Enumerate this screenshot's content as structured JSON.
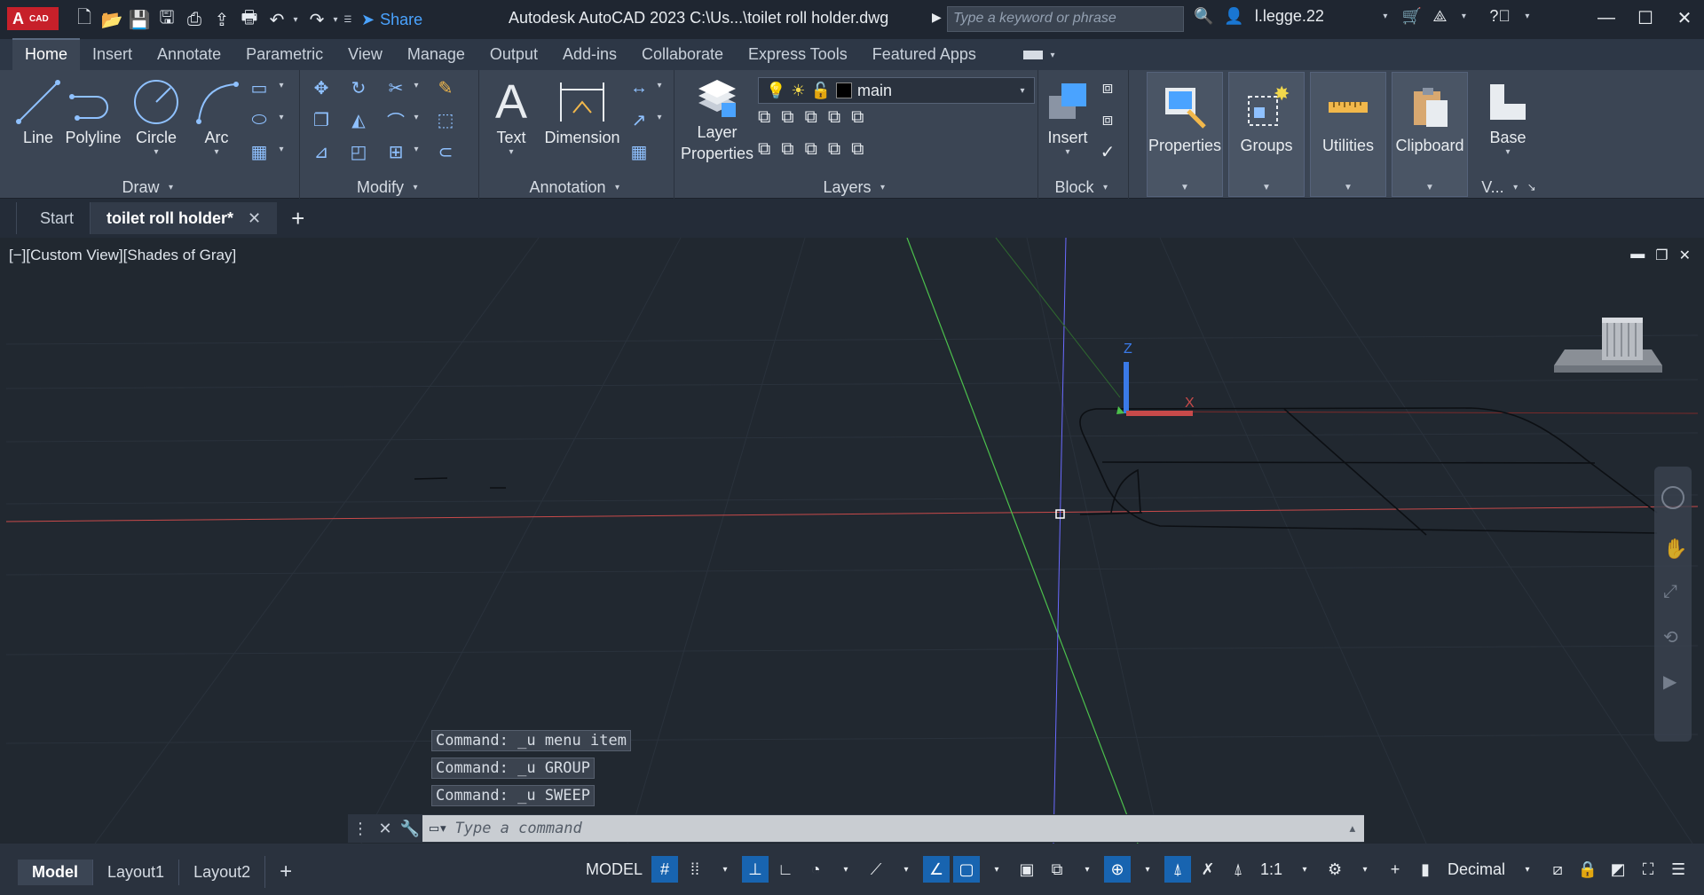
{
  "titlebar": {
    "app_logo": "A",
    "app_logo_sub": "CAD",
    "share_label": "Share",
    "title": "Autodesk AutoCAD 2023    C:\\Us...\\toilet roll holder.dwg",
    "search_placeholder": "Type a keyword or phrase",
    "username": "l.legge.22"
  },
  "ribbon_tabs": [
    "Home",
    "Insert",
    "Annotate",
    "Parametric",
    "View",
    "Manage",
    "Output",
    "Add-ins",
    "Collaborate",
    "Express Tools",
    "Featured Apps"
  ],
  "ribbon": {
    "draw": {
      "title": "Draw",
      "tools": [
        "Line",
        "Polyline",
        "Circle",
        "Arc"
      ]
    },
    "modify": {
      "title": "Modify"
    },
    "annotation": {
      "title": "Annotation",
      "tools": [
        "Text",
        "Dimension"
      ]
    },
    "layers": {
      "title": "Layers",
      "layer_properties": "Layer\nProperties",
      "current_layer": "main"
    },
    "block": {
      "title": "Block",
      "insert": "Insert"
    },
    "tiles": [
      "Properties",
      "Groups",
      "Utilities",
      "Clipboard"
    ],
    "view": {
      "base": "Base",
      "title": "V..."
    }
  },
  "doc_tabs": {
    "start": "Start",
    "active": "toilet roll holder*"
  },
  "viewport": {
    "label": "[−][Custom View][Shades of Gray]",
    "command_history": [
      "Command: _u menu item",
      "Command: _u GROUP",
      "Command: _u SWEEP"
    ],
    "command_placeholder": "Type a command",
    "ucs_x": "X",
    "ucs_z": "Z"
  },
  "statusbar": {
    "layout_tabs": [
      "Model",
      "Layout1",
      "Layout2"
    ],
    "model_label": "MODEL",
    "scale": "1:1",
    "units": "Decimal"
  },
  "colors": {
    "accent": "#1864b0",
    "logo_red": "#c7202a",
    "share_blue": "#4aa3ff",
    "y_axis_green": "#4cc04c",
    "x_axis_red": "#c84a4a",
    "z_axis_blue": "#6a6aff"
  }
}
